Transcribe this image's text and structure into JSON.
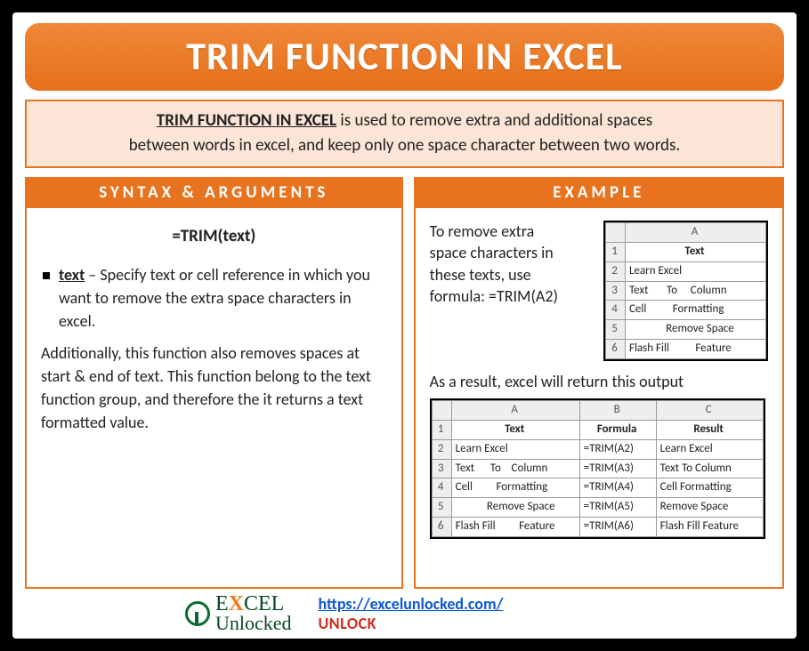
{
  "title": "TRIM FUNCTION IN EXCEL",
  "description": {
    "lead": "TRIM FUNCTION IN EXCEL",
    "rest1": " is used to remove extra and additional spaces",
    "rest2": "between words in excel, and keep only one space character between two words."
  },
  "left": {
    "heading": "SYNTAX & ARGUMENTS",
    "formula": "=TRIM(text)",
    "arg_name": "text",
    "arg_desc": " – Specify text or cell reference in which you want to remove the extra space characters in excel.",
    "extra": "Additionally, this function also removes spaces at start & end of text. This function belong to the text function group, and therefore the it returns a text formatted value."
  },
  "right": {
    "heading": "EXAMPLE",
    "intro": "To remove extra space characters in these texts, use formula: =TRIM(A2)",
    "table1": {
      "colA": "A",
      "header": "Text",
      "rows": [
        "Learn Excel",
        "Text       To     Column",
        "Cell          Formatting",
        "              Remove Space",
        "Flash Fill          Feature"
      ]
    },
    "result_line": "As a result, excel will return this output",
    "table2": {
      "cols": [
        "A",
        "B",
        "C"
      ],
      "headers": [
        "Text",
        "Formula",
        "Result"
      ],
      "rows": [
        [
          "Learn Excel",
          "=TRIM(A2)",
          "Learn Excel"
        ],
        [
          "Text      To    Column",
          "=TRIM(A3)",
          "Text To Column"
        ],
        [
          "Cell         Formatting",
          "=TRIM(A4)",
          "Cell Formatting"
        ],
        [
          "            Remove Space",
          "=TRIM(A5)",
          "Remove Space"
        ],
        [
          "Flash Fill         Feature",
          "=TRIM(A6)",
          "Flash Fill Feature"
        ]
      ]
    }
  },
  "footer": {
    "logo_top": "E",
    "logo_x": "X",
    "logo_rest": "CEL",
    "logo_bottom": "Unlocked",
    "link": "https://excelunlocked.com/",
    "tag": "UNLOCK"
  }
}
